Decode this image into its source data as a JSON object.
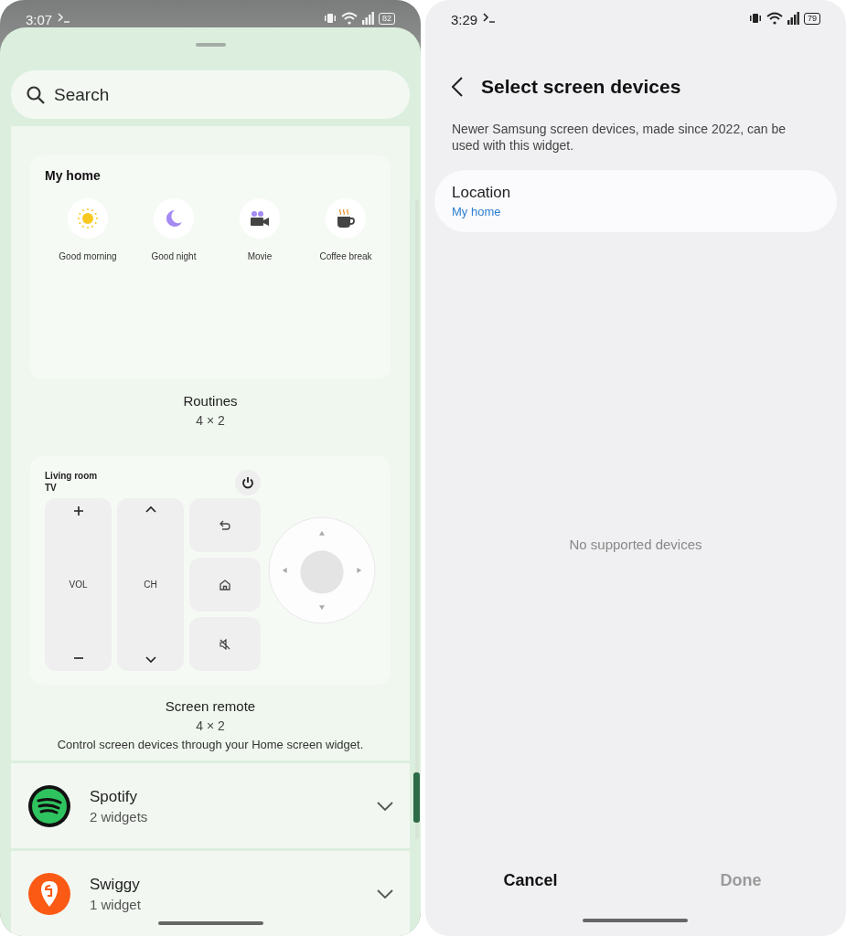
{
  "left_screen": {
    "status_bar": {
      "time": "3:07",
      "battery": "82"
    },
    "search": {
      "placeholder": "Search"
    },
    "routines_widget": {
      "location": "My home",
      "routines": [
        {
          "kind": "sun",
          "label": "Good morning"
        },
        {
          "kind": "moon",
          "label": "Good night"
        },
        {
          "kind": "movie",
          "label": "Movie"
        },
        {
          "kind": "coffee",
          "label": "Coffee break"
        }
      ],
      "name": "Routines",
      "size": "4 × 2"
    },
    "remote_widget": {
      "device": "Living room TV",
      "volume_label": "VOL",
      "channel_label": "CH",
      "name": "Screen remote",
      "size": "4 × 2",
      "description": "Control screen devices through your Home screen widget."
    },
    "apps": [
      {
        "kind": "spotify",
        "name": "Spotify",
        "count": "2 widgets",
        "expanded": false
      },
      {
        "kind": "swiggy",
        "name": "Swiggy",
        "count": "1 widget",
        "expanded": false
      }
    ]
  },
  "right_screen": {
    "status_bar": {
      "time": "3:29",
      "battery": "79"
    },
    "title": "Select screen devices",
    "description": "Newer Samsung screen devices, made since 2022, can be used with this widget.",
    "location": {
      "label": "Location",
      "value": "My home"
    },
    "empty_message": "No supported devices",
    "buttons": [
      {
        "label": "Cancel",
        "disabled": false
      },
      {
        "label": "Done",
        "disabled": true
      }
    ]
  }
}
